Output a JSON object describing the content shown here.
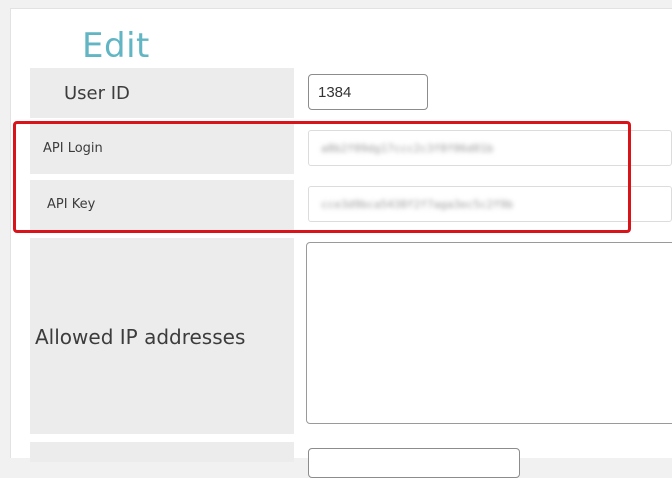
{
  "page": {
    "title": "Edit"
  },
  "fields": {
    "user_id": {
      "label": "User ID",
      "value": "1384"
    },
    "api_login": {
      "label": "API Login",
      "value": "a8b2f09dg17ccc2c3f8f06d01b"
    },
    "api_key": {
      "label": "API Key",
      "value": "cce3d9bca5438f2f7aga3ec5c2f9b"
    },
    "allowed_ip": {
      "label": "Allowed IP addresses",
      "value": ""
    }
  },
  "colors": {
    "title": "#62b6c4",
    "highlight": "#d8141a"
  }
}
